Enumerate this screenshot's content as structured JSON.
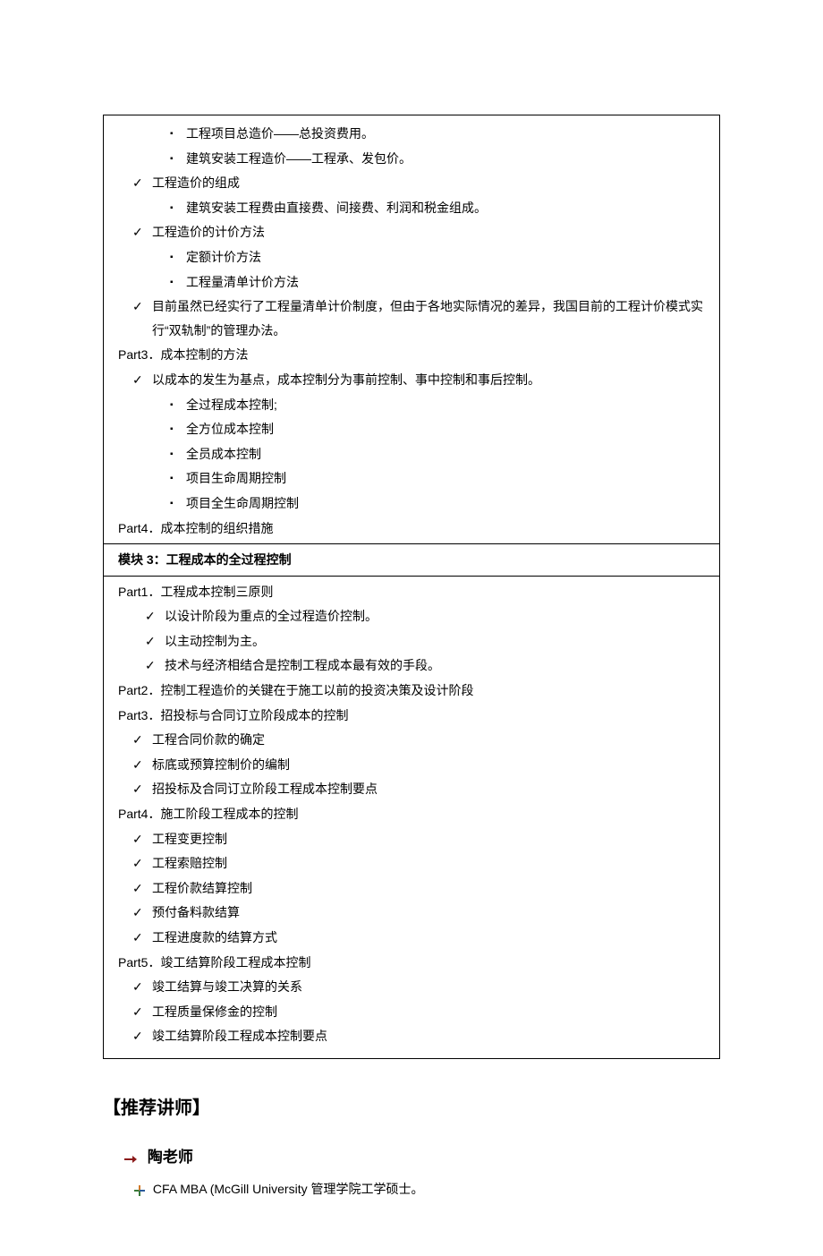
{
  "box1": {
    "dot_items_a": [
      "工程项目总造价——总投资费用。",
      "建筑安装工程造价——工程承、发包价。"
    ],
    "check1": "工程造价的组成",
    "dot_items_b": [
      "建筑安装工程费由直接费、间接费、利润和税金组成。"
    ],
    "check2": "工程造价的计价方法",
    "dot_items_c": [
      "定额计价方法",
      "工程量清单计价方法"
    ],
    "check3": "目前虽然已经实行了工程量清单计价制度，但由于各地实际情况的差异，我国目前的工程计价模式实行“双轨制”的管理办法。",
    "part3": "Part3．成本控制的方法",
    "check4": "以成本的发生为基点，成本控制分为事前控制、事中控制和事后控制。",
    "dot_items_d": [
      "全过程成本控制;",
      "全方位成本控制",
      "全员成本控制",
      "项目生命周期控制",
      "项目全生命周期控制"
    ],
    "part4": "Part4．成本控制的组织措施"
  },
  "module3_header": "模块 3：工程成本的全过程控制",
  "box2": {
    "part1": "Part1．工程成本控制三原则",
    "part1_checks": [
      "以设计阶段为重点的全过程造价控制。",
      "以主动控制为主。",
      "技术与经济相结合是控制工程成本最有效的手段。"
    ],
    "part2": "Part2．控制工程造价的关键在于施工以前的投资决策及设计阶段",
    "part3": "Part3．招投标与合同订立阶段成本的控制",
    "part3_checks": [
      "工程合同价款的确定",
      "标底或预算控制价的编制",
      "招投标及合同订立阶段工程成本控制要点"
    ],
    "part4": "Part4．施工阶段工程成本的控制",
    "part4_checks": [
      "工程变更控制",
      "工程索赔控制",
      "工程价款结算控制",
      "预付备料款结算",
      "工程进度款的结算方式"
    ],
    "part5": "Part5．竣工结算阶段工程成本控制",
    "part5_checks": [
      "竣工结算与竣工决算的关系",
      "工程质量保修金的控制",
      "竣工结算阶段工程成本控制要点"
    ]
  },
  "section_title": "【推荐讲师】",
  "lecturer": {
    "name": "陶老师",
    "credential": "CFA MBA (McGill University 管理学院工学硕士。"
  },
  "glyphs": {
    "check": "✓"
  }
}
